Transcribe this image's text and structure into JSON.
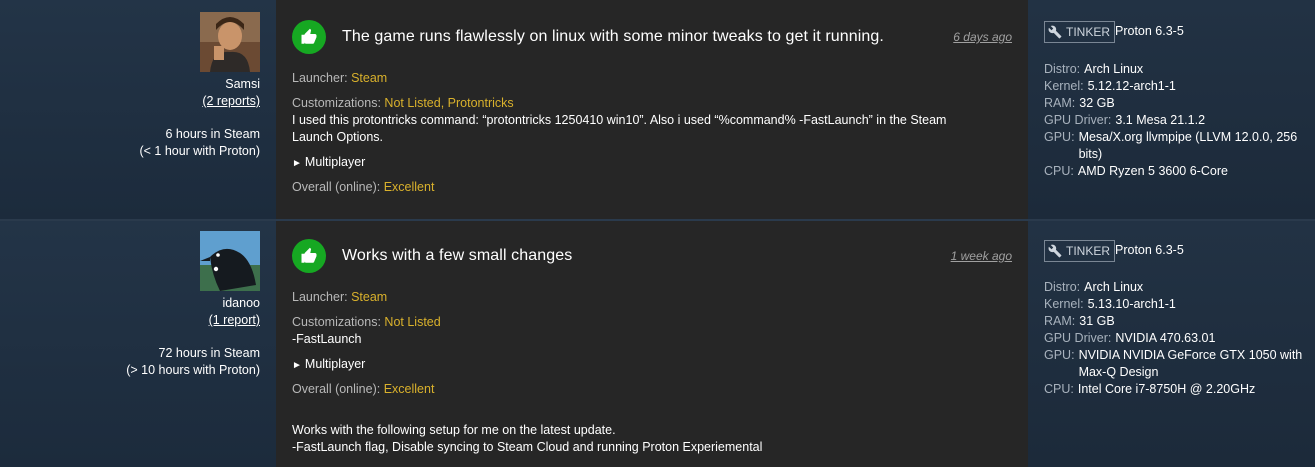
{
  "reports": [
    {
      "user": {
        "name": "Samsi",
        "reports_link": "(2 reports)",
        "hours_steam": "6 hours in Steam",
        "hours_proton": "(< 1 hour with Proton)"
      },
      "rating_icon": "thumbs-up-icon",
      "summary": "The game runs flawlessly on linux with some minor tweaks to get it running.",
      "date": "6 days ago",
      "launcher_label": "Launcher:",
      "launcher_value": "Steam",
      "customizations_label": "Customizations:",
      "customizations_value": "Not Listed, Protontricks",
      "notes": "I used this protontricks command: “protontricks 1250410 win10”. Also i used “%command% -FastLaunch” in the Steam Launch Options.",
      "multiplayer": "Multiplayer",
      "overall_label": "Overall (online):",
      "overall_value": "Excellent",
      "extra_notes": "",
      "tinker_label": "TINKER",
      "proton_version": "Proton 6.3-5",
      "specs": [
        {
          "k": "Distro:",
          "v": "Arch Linux"
        },
        {
          "k": "Kernel:",
          "v": "5.12.12-arch1-1"
        },
        {
          "k": "RAM:",
          "v": "32 GB"
        },
        {
          "k": "GPU Driver:",
          "v": "3.1 Mesa 21.1.2"
        },
        {
          "k": "GPU:",
          "v": "Mesa/X.org llvmpipe (LLVM 12.0.0, 256 bits)"
        },
        {
          "k": "CPU:",
          "v": "AMD Ryzen 5 3600 6-Core"
        }
      ]
    },
    {
      "user": {
        "name": "idanoo",
        "reports_link": "(1 report)",
        "hours_steam": "72 hours in Steam",
        "hours_proton": "(> 10 hours with Proton)"
      },
      "rating_icon": "thumbs-up-icon",
      "summary": "Works with a few small changes",
      "date": "1 week ago",
      "launcher_label": "Launcher:",
      "launcher_value": "Steam",
      "customizations_label": "Customizations:",
      "customizations_value": "Not Listed",
      "notes": "-FastLaunch",
      "multiplayer": "Multiplayer",
      "overall_label": "Overall (online):",
      "overall_value": "Excellent",
      "extra_notes_1": "Works with the following setup for me on the latest update.",
      "extra_notes_2": "-FastLaunch flag, Disable syncing to Steam Cloud and running Proton Experiemental",
      "tinker_label": "TINKER",
      "proton_version": "Proton 6.3-5",
      "specs": [
        {
          "k": "Distro:",
          "v": "Arch Linux"
        },
        {
          "k": "Kernel:",
          "v": "5.13.10-arch1-1"
        },
        {
          "k": "RAM:",
          "v": "31 GB"
        },
        {
          "k": "GPU Driver:",
          "v": "NVIDIA 470.63.01"
        },
        {
          "k": "GPU:",
          "v": "NVIDIA NVIDIA GeForce GTX 1050 with Max-Q Design"
        },
        {
          "k": "CPU:",
          "v": "Intel Core i7-8750H @ 2.20GHz"
        }
      ]
    }
  ],
  "colors": {
    "accent": "#d9b12c",
    "thumb": "#16a822",
    "panel": "#262626"
  }
}
